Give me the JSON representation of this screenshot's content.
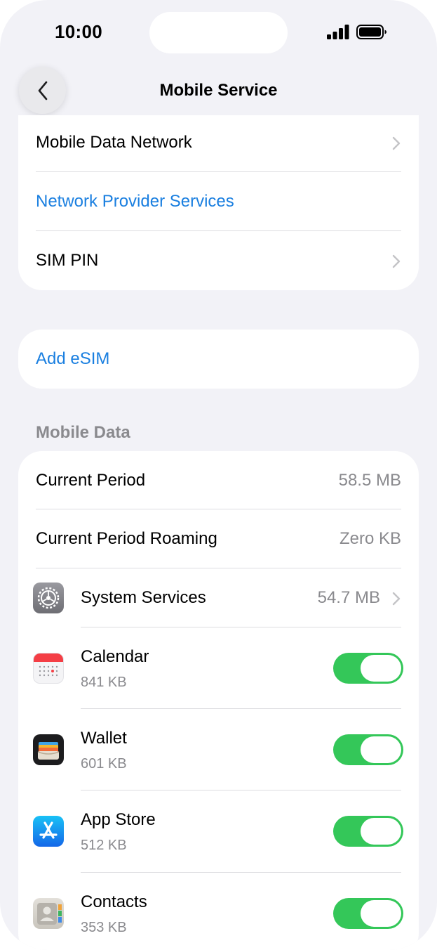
{
  "status_bar": {
    "time": "10:00"
  },
  "nav": {
    "title": "Mobile Service"
  },
  "top_group": {
    "items": [
      {
        "label": "Mobile Data Network"
      },
      {
        "label": "Network Provider Services"
      },
      {
        "label": "SIM PIN"
      }
    ]
  },
  "esim": {
    "label": "Add eSIM"
  },
  "mobile_data": {
    "header": "Mobile Data",
    "current_period": {
      "label": "Current Period",
      "value": "58.5 MB"
    },
    "current_period_roaming": {
      "label": "Current Period Roaming",
      "value": "Zero KB"
    },
    "system_services": {
      "label": "System Services",
      "value": "54.7 MB",
      "icon": "settings-gear-icon"
    },
    "apps": [
      {
        "name": "Calendar",
        "usage": "841 KB",
        "icon": "calendar-icon",
        "enabled": true
      },
      {
        "name": "Wallet",
        "usage": "601 KB",
        "icon": "wallet-icon",
        "enabled": true
      },
      {
        "name": "App Store",
        "usage": "512 KB",
        "icon": "app-store-icon",
        "enabled": true
      },
      {
        "name": "Contacts",
        "usage": "353 KB",
        "icon": "contacts-icon",
        "enabled": true
      }
    ]
  },
  "colors": {
    "accent": "#1a7fe0",
    "toggle_on": "#34c759",
    "background": "#f2f2f7"
  }
}
